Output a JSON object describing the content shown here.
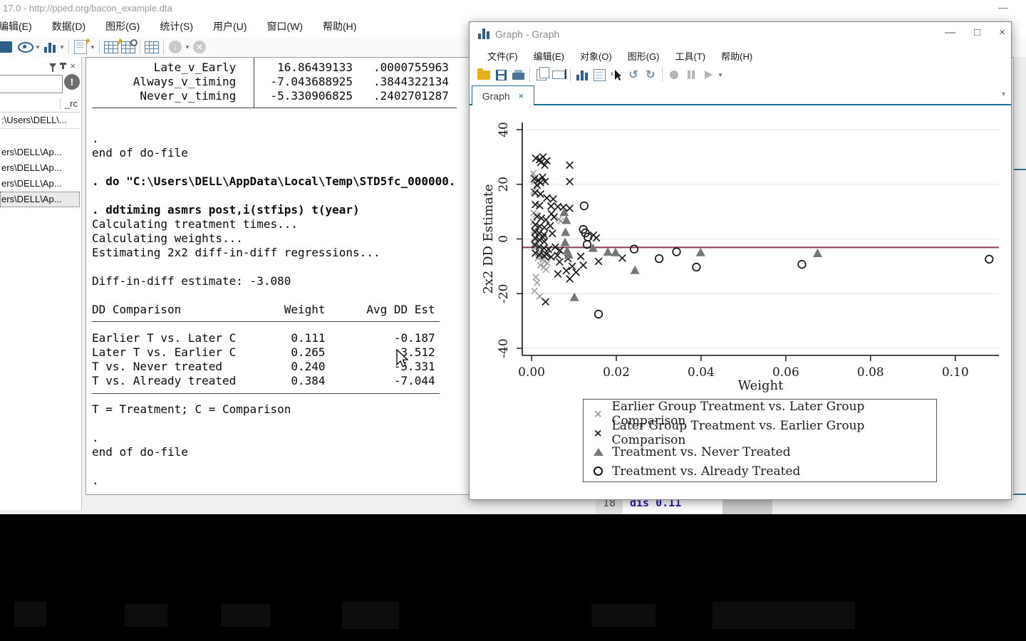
{
  "main_window": {
    "title": "17.0 - http://pped.org/bacon_example.dta",
    "controls": {
      "minimize": "—"
    },
    "menu": [
      "编辑(E)",
      "数据(D)",
      "图形(G)",
      "统计(S)",
      "用户(U)",
      "窗口(W)",
      "帮助(H)"
    ],
    "toolbar_icons": [
      "log",
      "viewer-eye",
      "graph",
      "dofile-editor",
      "data-editor",
      "data-browser",
      "variables-manager",
      "more-down",
      "break"
    ],
    "sidebar": {
      "panel_icons": [
        "filter",
        "pin",
        "close"
      ],
      "error_badge": "!",
      "header_label": "_rc",
      "rows": [
        {
          "text": ":\\Users\\DELL\\...",
          "selected": false,
          "first": true
        },
        {
          "text": "ers\\DELL\\Ap...",
          "selected": false,
          "first": false
        },
        {
          "text": "ers\\DELL\\Ap...",
          "selected": false,
          "first": false
        },
        {
          "text": "ers\\DELL\\Ap...",
          "selected": false,
          "first": false
        },
        {
          "text": "ers\\DELL\\Ap...",
          "selected": true,
          "first": false
        }
      ]
    },
    "output_lines": [
      {
        "text": "         Late_v_Early      16.86439133   .0000755963",
        "bold": false
      },
      {
        "text": "      Always_v_timing     -7.043688925   .3844322134",
        "bold": false
      },
      {
        "text": "       Never_v_timing     -5.330906825   .2402701287",
        "bold": false
      },
      {
        "text": "",
        "bold": false
      },
      {
        "text": "",
        "bold": false
      },
      {
        "text": ".",
        "bold": false
      },
      {
        "text": "end of do-file",
        "bold": false
      },
      {
        "text": "",
        "bold": false
      },
      {
        "text": ". do \"C:\\Users\\DELL\\AppData\\Local\\Temp\\STD5fc_000000.",
        "bold": true
      },
      {
        "text": "",
        "bold": false
      },
      {
        "text": ". ddtiming asmrs post,i(stfips) t(year)",
        "bold": true
      },
      {
        "text": "Calculating treatment times...",
        "bold": false
      },
      {
        "text": "Calculating weights...",
        "bold": false
      },
      {
        "text": "Estimating 2x2 diff-in-diff regressions...",
        "bold": false
      },
      {
        "text": "",
        "bold": false
      },
      {
        "text": "Diff-in-diff estimate: -3.080",
        "bold": false
      },
      {
        "text": "",
        "bold": false
      },
      {
        "text": "DD Comparison               Weight      Avg DD Est",
        "bold": false
      },
      {
        "text": "",
        "bold": false
      },
      {
        "text": "Earlier T vs. Later C        0.111          -0.187",
        "bold": false
      },
      {
        "text": "Later T vs. Earlier C        0.265           3.512",
        "bold": false
      },
      {
        "text": "T vs. Never treated          0.240          -5.331",
        "bold": false
      },
      {
        "text": "T vs. Already treated        0.384          -7.044",
        "bold": false
      },
      {
        "text": "",
        "bold": false
      },
      {
        "text": "T = Treatment; C = Comparison",
        "bold": false
      },
      {
        "text": "",
        "bold": false
      },
      {
        "text": ".",
        "bold": false
      },
      {
        "text": "end of do-file",
        "bold": false
      },
      {
        "text": "",
        "bold": false
      },
      {
        "text": ".",
        "bold": false
      }
    ]
  },
  "editor_fragment": {
    "line_no": "18",
    "code": "dis 0.11"
  },
  "graph_window": {
    "title": "Graph - Graph",
    "controls": {
      "minimize": "—",
      "maximize": "□",
      "close": "×"
    },
    "menu": [
      "文件(F)",
      "编辑(E)",
      "对象(O)",
      "图形(G)",
      "工具(T)",
      "帮助(H)"
    ],
    "toolbar_icons": [
      "open",
      "save",
      "print",
      "copy",
      "copy-as-name",
      "graph",
      "log",
      "pointer",
      "undo",
      "redo",
      "record",
      "pause",
      "play",
      "more"
    ],
    "undo_glyph": "↺",
    "redo_glyph": "↻",
    "tab": {
      "label": "Graph",
      "close": "×"
    },
    "tabbar_caret": "▾"
  },
  "chart_data": {
    "type": "scatter",
    "title": "",
    "xlabel": "Weight",
    "ylabel": "2x2 DD Estimate",
    "xlim": [
      -0.0022,
      0.1103
    ],
    "ylim": [
      -42.6,
      42.6
    ],
    "xticks": [
      0.0,
      0.02,
      0.04,
      0.06,
      0.08,
      0.1
    ],
    "yticks": [
      -40,
      -20,
      0,
      20,
      40
    ],
    "grid": true,
    "legend_position": "bottom",
    "hline": {
      "value": -3.08,
      "color": "#8b3a55"
    },
    "series": [
      {
        "name": "Earlier Group Treatment vs. Later Group Comparison",
        "marker": "x",
        "color": "#9b9b9b",
        "points": [
          [
            0.0004,
            24
          ],
          [
            0.0009,
            22.5
          ],
          [
            0.0006,
            21
          ],
          [
            0.0013,
            20
          ],
          [
            0.0004,
            17.5
          ],
          [
            0.0009,
            16.5
          ],
          [
            0.0005,
            9.5
          ],
          [
            0.001,
            8.8
          ],
          [
            0.0064,
            7.2
          ],
          [
            0.0069,
            6.6
          ],
          [
            0.0004,
            6.2
          ],
          [
            0.0009,
            5.2
          ],
          [
            0.0014,
            4.2
          ],
          [
            0.0006,
            3.2
          ],
          [
            0.0011,
            2.4
          ],
          [
            0.0016,
            1.4
          ],
          [
            0.0007,
            0.4
          ],
          [
            0.0012,
            -0.8
          ],
          [
            0.0005,
            -2
          ],
          [
            0.001,
            -3
          ],
          [
            0.0015,
            -4
          ],
          [
            0.0021,
            -5
          ],
          [
            0.0026,
            -6
          ],
          [
            0.0015,
            -7
          ],
          [
            0.0027,
            -7.6
          ],
          [
            0.0031,
            -8.2
          ],
          [
            0.0037,
            -8.8
          ],
          [
            0.0021,
            -9.6
          ],
          [
            0.0029,
            -10.4
          ],
          [
            0.0034,
            -11.2
          ],
          [
            0.001,
            -14
          ],
          [
            0.0013,
            -16
          ],
          [
            0.0007,
            -19
          ],
          [
            0.0019,
            -21
          ]
        ]
      },
      {
        "name": "Later Group Treatment vs. Earlier Group Comparison",
        "marker": "x",
        "color": "#1a1a1a",
        "points": [
          [
            0.001,
            29.5
          ],
          [
            0.0019,
            29
          ],
          [
            0.0027,
            30
          ],
          [
            0.0022,
            28
          ],
          [
            0.0036,
            28.6
          ],
          [
            0.0031,
            27
          ],
          [
            0.009,
            27
          ],
          [
            0.0007,
            22
          ],
          [
            0.0016,
            21.5
          ],
          [
            0.0026,
            22.6
          ],
          [
            0.0021,
            20.6
          ],
          [
            0.0013,
            19.6
          ],
          [
            0.0032,
            21
          ],
          [
            0.009,
            21
          ],
          [
            0.0008,
            17
          ],
          [
            0.0021,
            16.4
          ],
          [
            0.0036,
            15
          ],
          [
            0.0051,
            14.6
          ],
          [
            0.0009,
            12.6
          ],
          [
            0.0019,
            12.2
          ],
          [
            0.0046,
            12
          ],
          [
            0.0062,
            11.8
          ],
          [
            0.0075,
            11.6
          ],
          [
            0.009,
            11.2
          ],
          [
            0.0047,
            9.2
          ],
          [
            0.0013,
            8.2
          ],
          [
            0.0023,
            7.6
          ],
          [
            0.0034,
            7
          ],
          [
            0.0053,
            8
          ],
          [
            0.0009,
            5.2
          ],
          [
            0.0019,
            4.6
          ],
          [
            0.003,
            4.2
          ],
          [
            0.0044,
            4.8
          ],
          [
            0.0008,
            2.6
          ],
          [
            0.0018,
            2.2
          ],
          [
            0.0029,
            1.6
          ],
          [
            0.0049,
            2
          ],
          [
            0.0009,
            0.2
          ],
          [
            0.0019,
            -0.4
          ],
          [
            0.003,
            -1
          ],
          [
            0.0027,
            0.6
          ],
          [
            0.0008,
            -2.2
          ],
          [
            0.0018,
            -2.8
          ],
          [
            0.0029,
            -3.4
          ],
          [
            0.004,
            -3.8
          ],
          [
            0.0056,
            -3
          ],
          [
            0.0067,
            -4.2
          ],
          [
            0.0009,
            -5.2
          ],
          [
            0.0019,
            -5.8
          ],
          [
            0.003,
            -6.2
          ],
          [
            0.0046,
            -6.6
          ],
          [
            0.0061,
            -6
          ],
          [
            0.0035,
            -5.6
          ],
          [
            0.0116,
            -6.4
          ],
          [
            0.0146,
            1.4
          ],
          [
            0.0153,
            0.4
          ],
          [
            0.0158,
            -8.2
          ],
          [
            0.0214,
            -7
          ],
          [
            0.0122,
            -9.6
          ],
          [
            0.0086,
            -7.2
          ],
          [
            0.0066,
            -8.4
          ],
          [
            0.0096,
            -10
          ],
          [
            0.0082,
            -11.6
          ],
          [
            0.0105,
            -12.2
          ],
          [
            0.009,
            -14.6
          ],
          [
            0.0033,
            -23
          ],
          [
            0.0062,
            -12.8
          ]
        ]
      },
      {
        "name": "Treatment vs. Never Treated",
        "marker": "triangle",
        "color": "#767676",
        "points": [
          [
            0.0077,
            9.8
          ],
          [
            0.0082,
            6.9
          ],
          [
            0.008,
            2.5
          ],
          [
            0.0079,
            -1.2
          ],
          [
            0.0084,
            -4.3
          ],
          [
            0.0088,
            -5.8
          ],
          [
            0.0145,
            -3.3
          ],
          [
            0.018,
            -4.7
          ],
          [
            0.0198,
            -4.9
          ],
          [
            0.0244,
            -11.4
          ],
          [
            0.0399,
            -4.9
          ],
          [
            0.0675,
            -5.2
          ],
          [
            0.0101,
            -21.3
          ]
        ]
      },
      {
        "name": "Treatment vs. Already Treated",
        "marker": "circle",
        "color": "#151515",
        "points": [
          [
            0.0124,
            12.1
          ],
          [
            0.0122,
            3.5
          ],
          [
            0.0127,
            2.2
          ],
          [
            0.0133,
            0.7
          ],
          [
            0.0131,
            -2
          ],
          [
            0.0158,
            -27.5
          ],
          [
            0.0242,
            -3.7
          ],
          [
            0.0301,
            -7.2
          ],
          [
            0.0342,
            -4.7
          ],
          [
            0.0389,
            -10.3
          ],
          [
            0.0638,
            -9.3
          ],
          [
            0.108,
            -7.4
          ]
        ]
      }
    ]
  }
}
